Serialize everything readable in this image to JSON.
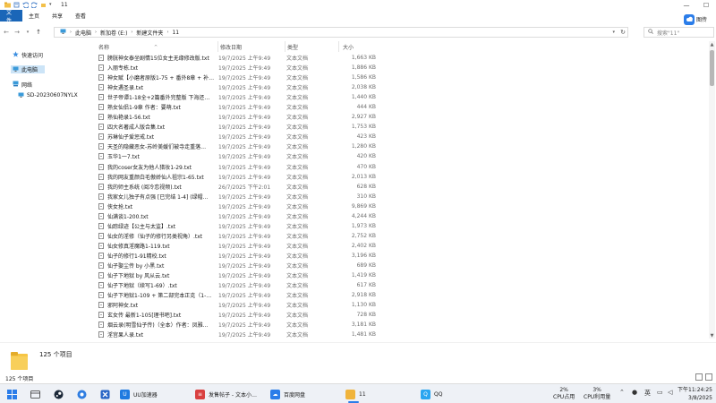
{
  "window": {
    "title": "11",
    "controls": {
      "minimize": "—",
      "maximize": "☐"
    }
  },
  "ribbon": {
    "tabs": [
      {
        "label": "文件",
        "active": true
      },
      {
        "label": "主页"
      },
      {
        "label": "共享"
      },
      {
        "label": "查看"
      }
    ]
  },
  "cloud": {
    "label": "图传"
  },
  "address": {
    "crumbs": [
      "此电脑",
      "新加卷 (E:)",
      "新建文件夹",
      "11"
    ],
    "search_placeholder": "搜索\"11\""
  },
  "nav": {
    "items": [
      {
        "label": "快速访问"
      },
      {
        "label": "此电脑",
        "selected": true
      },
      {
        "label": "网络"
      },
      {
        "label": "SD-20230607NYLX"
      }
    ]
  },
  "columns": {
    "name": "名称",
    "date": "修改日期",
    "type": "类型",
    "size": "大小"
  },
  "files": [
    {
      "name": "膀胱神女泰坐剧情15位女主无缘修改版.txt",
      "date": "19/7/2025 上午9:49",
      "type": "文本文档",
      "size": "1,663 KB"
    },
    {
      "name": "入丽专栋.txt",
      "date": "19/7/2025 上午9:49",
      "type": "文本文档",
      "size": "1,886 KB"
    },
    {
      "name": "神女赋【小磨者原版1-75 + 番外8章 + 补…",
      "date": "19/7/2025 上午9:49",
      "type": "文本文档",
      "size": "1,586 KB"
    },
    {
      "name": "神女遇圣录.txt",
      "date": "19/7/2025 上午9:49",
      "type": "文本文档",
      "size": "2,038 KB"
    },
    {
      "name": "世子帝谭1-18全+2篇番外完整版 下海还…",
      "date": "19/7/2025 上午9:49",
      "type": "文本文档",
      "size": "1,440 KB"
    },
    {
      "name": "熟女仙侣1-9章 作者：要萌.txt",
      "date": "19/7/2025 上午9:49",
      "type": "文本文档",
      "size": "444 KB"
    },
    {
      "name": "熟仙艳录1-56.txt",
      "date": "19/7/2025 上午9:49",
      "type": "文本文档",
      "size": "2,927 KB"
    },
    {
      "name": "四大名著成人版合集.txt",
      "date": "19/7/2025 上午9:49",
      "type": "文本文档",
      "size": "1,753 KB"
    },
    {
      "name": "苏琳仙子爱惩戒.txt",
      "date": "19/7/2025 上午9:49",
      "type": "文本文档",
      "size": "423 KB"
    },
    {
      "name": "天圣的隐藏恶女-苏岭美媛们被寺走重落…",
      "date": "19/7/2025 上午9:49",
      "type": "文本文档",
      "size": "1,280 KB"
    },
    {
      "name": "玉华1一7.txt",
      "date": "19/7/2025 上午9:49",
      "type": "文本文档",
      "size": "420 KB"
    },
    {
      "name": "我的coser女友为他人猎妆1-29.txt",
      "date": "19/7/2025 上午9:49",
      "type": "文本文档",
      "size": "470 KB"
    },
    {
      "name": "我的网友重颜白毛傲娇仙人祖宗1-65.txt",
      "date": "19/7/2025 上午9:49",
      "type": "文本文档",
      "size": "2,013 KB"
    },
    {
      "name": "我的师主系统 (阅冷恋视频).txt",
      "date": "26/7/2025 下午2:01",
      "type": "文本文档",
      "size": "628 KB"
    },
    {
      "name": "我家女儿独子有点强 [已完结 1-4] (绿帽…",
      "date": "19/7/2025 上午9:49",
      "type": "文本文档",
      "size": "310 KB"
    },
    {
      "name": "侠女抢.txt",
      "date": "19/7/2025 上午9:49",
      "type": "文本文档",
      "size": "9,869 KB"
    },
    {
      "name": "仙满谈1-200.txt",
      "date": "19/7/2025 上午9:49",
      "type": "文本文档",
      "size": "4,244 KB"
    },
    {
      "name": "仙踪绿迹【公主与太监】.txt",
      "date": "19/7/2025 上午9:49",
      "type": "文本文档",
      "size": "1,973 KB"
    },
    {
      "name": "仙女的淫修（仙子的修行另类视角）.txt",
      "date": "19/7/2025 上午9:49",
      "type": "文本文档",
      "size": "2,752 KB"
    },
    {
      "name": "仙女修真淫魔路1-119.txt",
      "date": "19/7/2025 上午9:49",
      "type": "文本文档",
      "size": "2,402 KB"
    },
    {
      "name": "仙子的修行1-91精校.txt",
      "date": "19/7/2025 上午9:49",
      "type": "文本文档",
      "size": "3,196 KB"
    },
    {
      "name": "仙子娶尘传 by 小黑.txt",
      "date": "19/7/2025 上午9:49",
      "type": "文本文档",
      "size": "689 KB"
    },
    {
      "name": "仙子下地狱 by 风从云.txt",
      "date": "19/7/2025 上午9:49",
      "type": "文本文档",
      "size": "1,419 KB"
    },
    {
      "name": "仙子下地狱（续写1-69）.txt",
      "date": "19/7/2025 上午9:49",
      "type": "文本文档",
      "size": "617 KB"
    },
    {
      "name": "仙子下地狱1-109 + 第二部完本正克（1-…",
      "date": "19/7/2025 上午9:49",
      "type": "文本文档",
      "size": "2,918 KB"
    },
    {
      "name": "邪阿神女.txt",
      "date": "19/7/2025 上午9:49",
      "type": "文本文档",
      "size": "1,130 KB"
    },
    {
      "name": "玄女传 最新1-105[理书吧].txt",
      "date": "19/7/2025 上午9:49",
      "type": "文本文档",
      "size": "728 KB"
    },
    {
      "name": "烟云录(明雪仙子传)（全本）作者：凤雅…",
      "date": "19/7/2025 上午9:49",
      "type": "文本文档",
      "size": "3,181 KB"
    },
    {
      "name": "淫宫果人录.txt",
      "date": "19/7/2025 上午9:49",
      "type": "文本文档",
      "size": "1,481 KB"
    }
  ],
  "details": {
    "count": "125 个项目"
  },
  "status": {
    "count": "125 个项目"
  },
  "taskbar": {
    "apps": [
      {
        "label": "UU加速器",
        "color": "#1f7ae0"
      },
      {
        "label": "发售帖子 - 文本小…",
        "color": "#d94141"
      },
      {
        "label": "百度网盘",
        "color": "#2b7de9"
      },
      {
        "label": "11",
        "color": "#f0b43c",
        "active": true
      },
      {
        "label": "QQ",
        "color": "#2aa5f0"
      }
    ],
    "cpu": {
      "value": "2%",
      "label": "CPU占用"
    },
    "cpu_temp": {
      "value": "3%",
      "label": "CPU利用量"
    },
    "clock": {
      "time": "下午11:24:25",
      "date": "3/8/2025"
    },
    "tray_input": "英"
  }
}
